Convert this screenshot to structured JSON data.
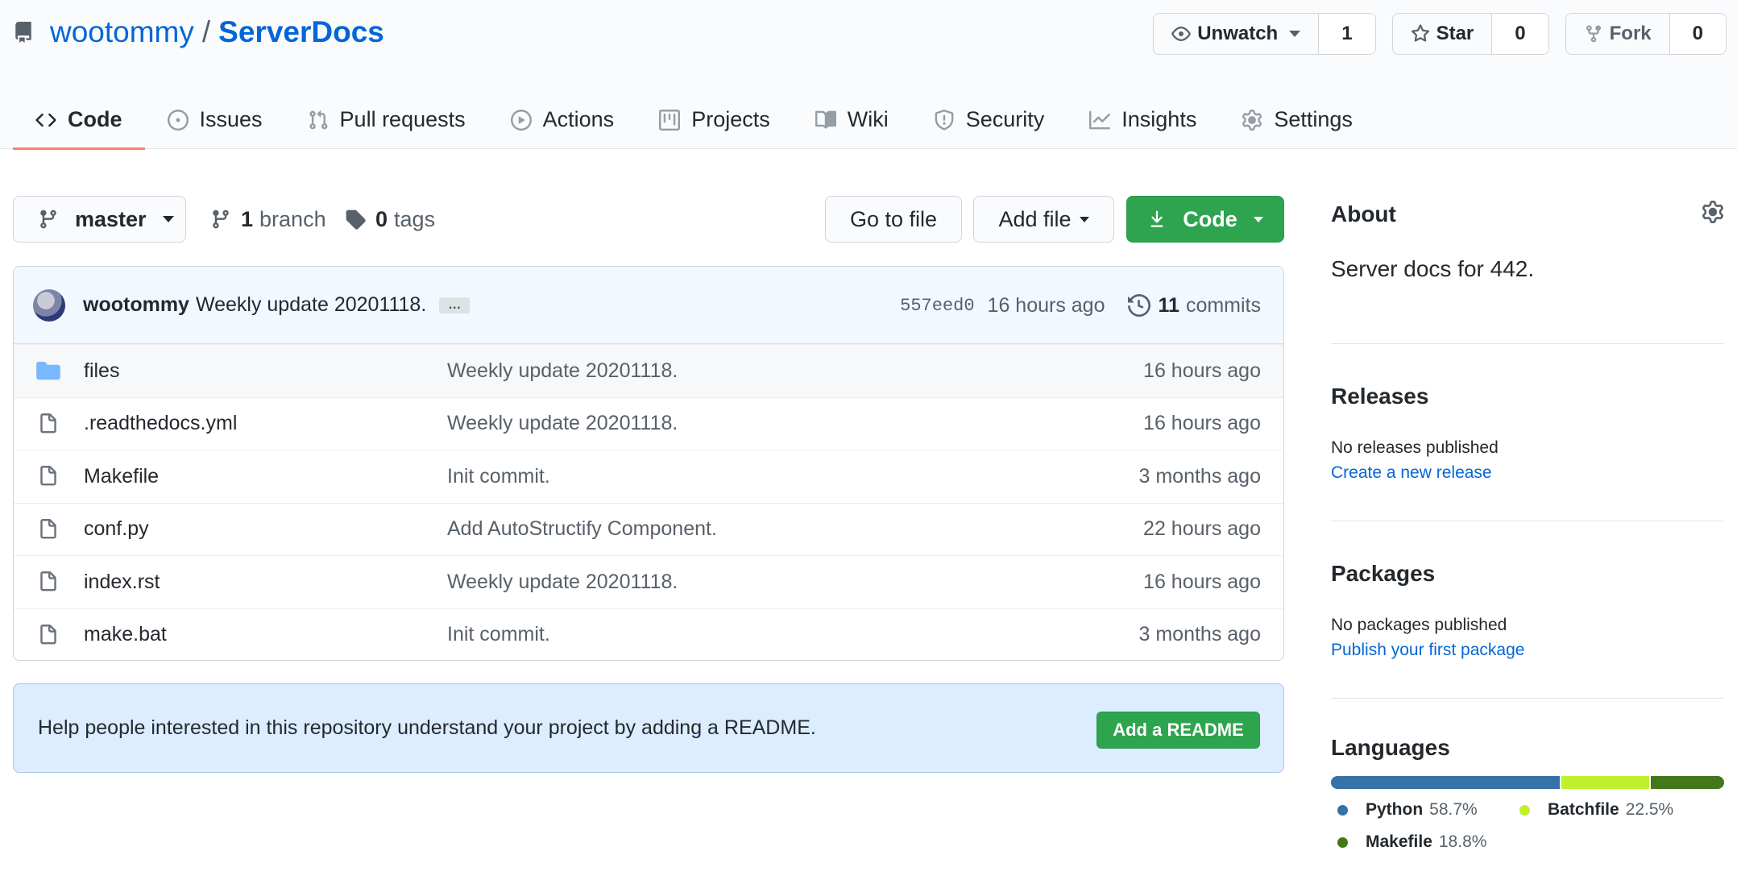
{
  "repo": {
    "owner": "wootommy",
    "separator": "/",
    "name": "ServerDocs"
  },
  "actions": {
    "watch_label": "Unwatch",
    "watch_count": "1",
    "star_label": "Star",
    "star_count": "0",
    "fork_label": "Fork",
    "fork_count": "0"
  },
  "tabs": [
    {
      "label": "Code",
      "icon": "code-icon",
      "selected": true
    },
    {
      "label": "Issues",
      "icon": "issue-icon"
    },
    {
      "label": "Pull requests",
      "icon": "pull-request-icon"
    },
    {
      "label": "Actions",
      "icon": "play-icon"
    },
    {
      "label": "Projects",
      "icon": "project-icon"
    },
    {
      "label": "Wiki",
      "icon": "book-icon"
    },
    {
      "label": "Security",
      "icon": "shield-icon"
    },
    {
      "label": "Insights",
      "icon": "graph-icon"
    },
    {
      "label": "Settings",
      "icon": "gear-icon"
    }
  ],
  "file_nav": {
    "branch": "master",
    "branch_count": "1",
    "branch_label": "branch",
    "tag_count": "0",
    "tag_label": "tags",
    "go_to_file": "Go to file",
    "add_file": "Add file",
    "code": "Code"
  },
  "commit": {
    "author": "wootommy",
    "message": "Weekly update 20201118.",
    "ellipsis": "…",
    "sha": "557eed0",
    "time": "16 hours ago",
    "count": "11",
    "count_label": "commits"
  },
  "files": [
    {
      "name": "files",
      "type": "dir",
      "message": "Weekly update 20201118.",
      "age": "16 hours ago"
    },
    {
      "name": ".readthedocs.yml",
      "type": "file",
      "message": "Weekly update 20201118.",
      "age": "16 hours ago"
    },
    {
      "name": "Makefile",
      "type": "file",
      "message": "Init commit.",
      "age": "3 months ago"
    },
    {
      "name": "conf.py",
      "type": "file",
      "message": "Add AutoStructify Component.",
      "age": "22 hours ago"
    },
    {
      "name": "index.rst",
      "type": "file",
      "message": "Weekly update 20201118.",
      "age": "16 hours ago"
    },
    {
      "name": "make.bat",
      "type": "file",
      "message": "Init commit.",
      "age": "3 months ago"
    }
  ],
  "readme": {
    "text": "Help people interested in this repository understand your project by adding a README.",
    "button": "Add a README"
  },
  "sidebar": {
    "about_title": "About",
    "about_desc": "Server docs for 442.",
    "releases_title": "Releases",
    "releases_sub": "No releases published",
    "releases_link": "Create a new release",
    "packages_title": "Packages",
    "packages_sub": "No packages published",
    "packages_link": "Publish your first package",
    "languages_title": "Languages",
    "languages": [
      {
        "name": "Python",
        "percent": "58.7%",
        "value": 58.7,
        "color": "#3572A5"
      },
      {
        "name": "Batchfile",
        "percent": "22.5%",
        "value": 22.5,
        "color": "#C1F12E"
      },
      {
        "name": "Makefile",
        "percent": "18.8%",
        "value": 18.8,
        "color": "#427819"
      }
    ]
  },
  "colors": {
    "link": "#0366d6",
    "primary_button": "#2ea44f",
    "tab_underline": "#f9826c",
    "commit_bar": "#f1f8ff",
    "readme_bg": "#dbedff",
    "folder": "#79b8ff"
  }
}
